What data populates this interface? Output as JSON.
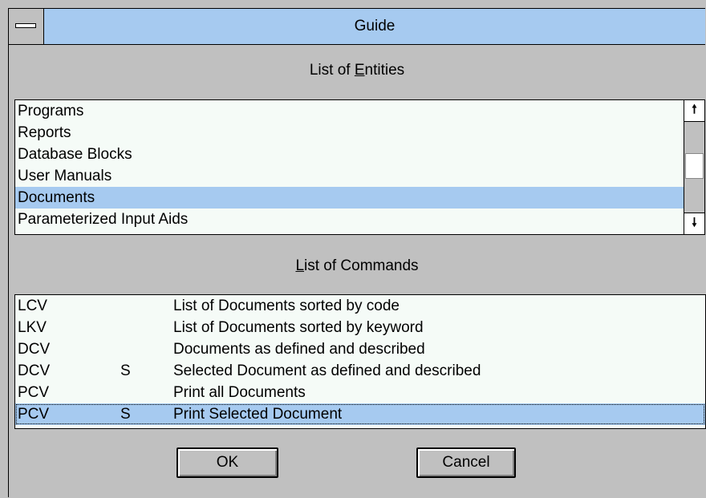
{
  "window": {
    "title": "Guide"
  },
  "entities": {
    "caption_pre": "List of ",
    "caption_mnemonic": "E",
    "caption_post": "ntities",
    "items": [
      "Programs",
      "Reports",
      "Database Blocks",
      "User Manuals",
      "Documents",
      "Parameterized Input Aids"
    ],
    "selected_index": 4
  },
  "commands": {
    "caption_mnemonic": "L",
    "caption_post": "ist of Commands",
    "rows": [
      {
        "code": "LCV",
        "flag": "",
        "desc": "List of Documents sorted by code"
      },
      {
        "code": "LKV",
        "flag": "",
        "desc": "List of Documents sorted by keyword"
      },
      {
        "code": "DCV",
        "flag": "",
        "desc": "Documents as defined and described"
      },
      {
        "code": "DCV",
        "flag": "S",
        "desc": "Selected Document as defined and described"
      },
      {
        "code": "PCV",
        "flag": "",
        "desc": "Print all Documents"
      },
      {
        "code": "PCV",
        "flag": "S",
        "desc": "Print Selected Document"
      }
    ],
    "selected_index": 5
  },
  "buttons": {
    "ok": "OK",
    "cancel": "Cancel"
  },
  "colors": {
    "selection": "#a6caf0",
    "face": "#c0c0c0",
    "list_bg": "#f5fbf7"
  },
  "icons": {
    "system_menu": "system-menu-icon",
    "scroll_up": "arrow-up-icon",
    "scroll_down": "arrow-down-icon"
  }
}
